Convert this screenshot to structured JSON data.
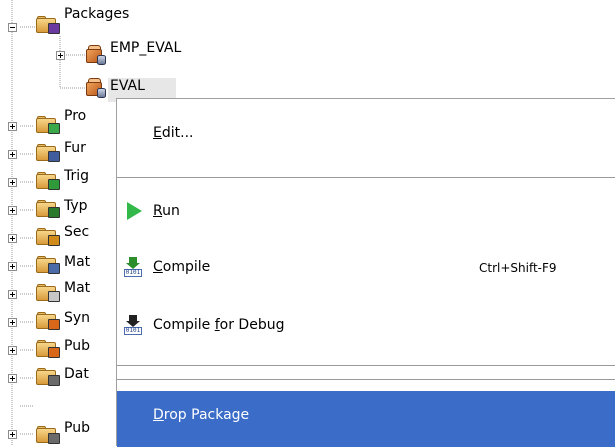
{
  "tree": {
    "packages_label": "Packages",
    "children": [
      {
        "label": "EMP_EVAL"
      },
      {
        "label": "EVAL"
      }
    ],
    "folders": [
      {
        "label": "Pro",
        "badge_color": "#38a84a"
      },
      {
        "label": "Fur",
        "badge_color": "#3f5d9c"
      },
      {
        "label": "Trig",
        "badge_color": "#2f9a3a"
      },
      {
        "label": "Typ",
        "badge_color": "#2b7a2b"
      },
      {
        "label": "Sec",
        "badge_color": "#d08b1a"
      },
      {
        "label": "Mat",
        "badge_color": "#4a6aa8"
      },
      {
        "label": "Mat",
        "badge_color": "#c7c7c7"
      },
      {
        "label": "Syn",
        "badge_color": "#d8671a"
      },
      {
        "label": "Pub",
        "badge_color": "#d8671a"
      },
      {
        "label": "Dat",
        "badge_color": "#6a6a6a"
      },
      {
        "label": "Pub",
        "badge_color": "#6a6a6a"
      }
    ]
  },
  "menu": {
    "edit": {
      "label": "Edit...",
      "mnemonic": "E",
      "rest": "dit..."
    },
    "run": {
      "label": "Run",
      "mnemonic": "R",
      "rest": "un"
    },
    "compile": {
      "label": "Compile",
      "mnemonic": "C",
      "rest": "ompile",
      "shortcut": "Ctrl+Shift-F9",
      "icon_text": "0101"
    },
    "compile_debug": {
      "pre": "Compile ",
      "mnemonic": "f",
      "rest": "or Debug",
      "icon_text": "0101"
    },
    "drop": {
      "label": "Drop Package",
      "mnemonic": "D",
      "rest": "rop Package"
    }
  },
  "colors": {
    "highlight": "#3a6cc8",
    "run_green": "#33b84a"
  }
}
